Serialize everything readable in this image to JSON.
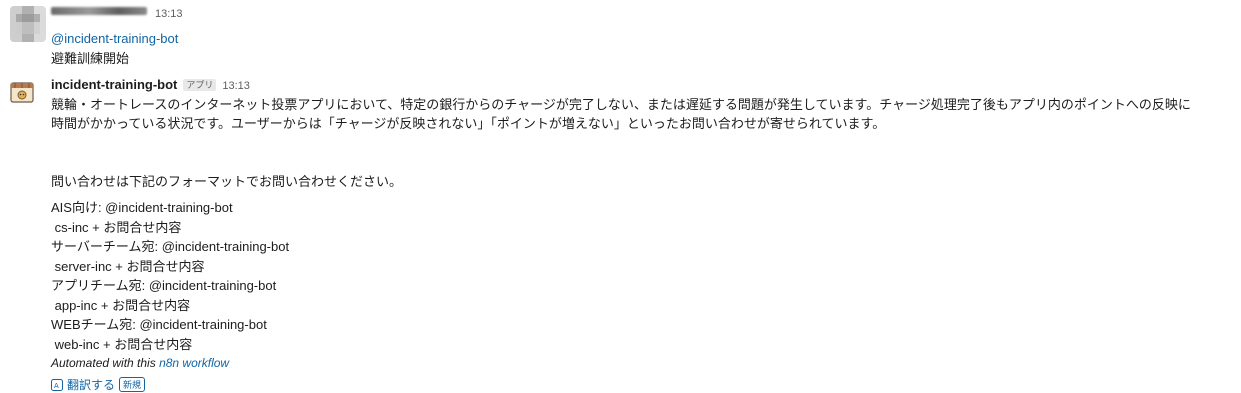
{
  "message1": {
    "timestamp": "13:13",
    "mention": "@incident-training-bot",
    "text": "避難訓練開始"
  },
  "message2": {
    "bot_name": "incident-training-bot",
    "app_badge": "アプリ",
    "timestamp": "13:13",
    "paragraph1_line1": "競輪・オートレースのインターネット投票アプリにおいて、特定の銀行からのチャージが完了しない、または遅延する問題が発生しています。チャージ処理完了後もアプリ内のポイントへの反映に",
    "paragraph1_line2": "時間がかかっている状況です。ユーザーからは「チャージが反映されない」「ポイントが増えない」といったお問い合わせが寄せられています。",
    "intro": "問い合わせは下記のフォーマットでお問い合わせください。",
    "format_lines": [
      "AIS向け: @incident-training-bot",
      " cs-inc + お問合せ内容",
      "サーバーチーム宛: @incident-training-bot",
      " server-inc + お問合せ内容",
      "アプリチーム宛: @incident-training-bot",
      " app-inc + お問合せ内容",
      "WEBチーム宛: @incident-training-bot",
      " web-inc + お問合せ内容"
    ],
    "automated_prefix": "Automated with this ",
    "automated_link": "n8n workflow"
  },
  "translate": {
    "label": "翻訳する",
    "badge": "新規"
  },
  "colors": {
    "link": "#1264a3",
    "text": "#1d1c1d",
    "muted": "#616061"
  }
}
